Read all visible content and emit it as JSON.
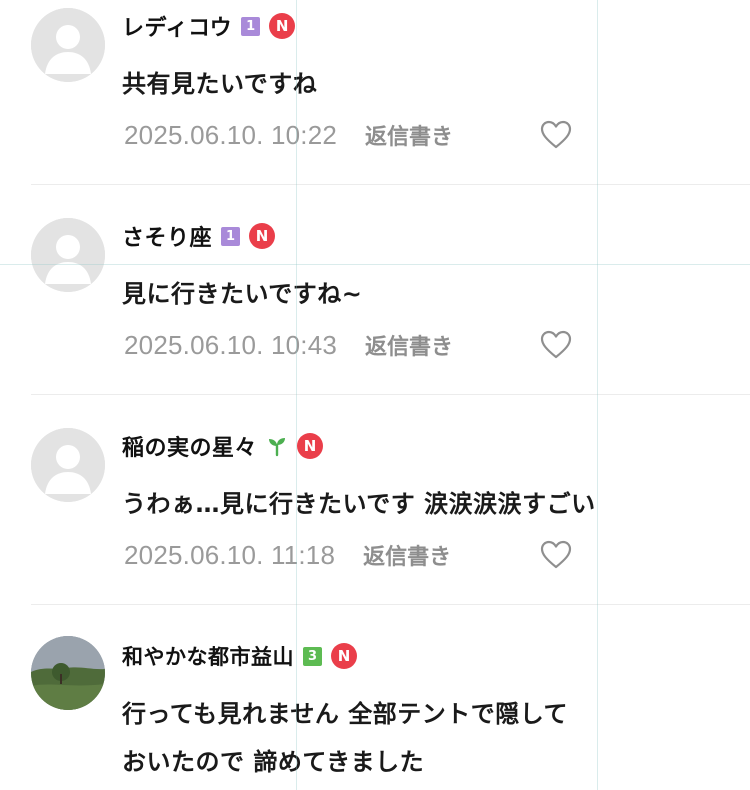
{
  "comments": [
    {
      "nickname": "レディコウ",
      "level": "1",
      "new_badge": "N",
      "text": "共有見たいですね",
      "date": "2025.06.10. 10:22",
      "reply_label": "返信書き"
    },
    {
      "nickname": "さそり座",
      "level": "1",
      "new_badge": "N",
      "text": "見に行きたいですね~",
      "date": "2025.06.10. 10:43",
      "reply_label": "返信書き"
    },
    {
      "nickname": "稲の実の星々",
      "new_badge": "N",
      "text": "うわぁ…見に行きたいです 涙涙涙涙すごい",
      "date": "2025.06.10. 11:18",
      "reply_label": "返信書き"
    },
    {
      "nickname": "和やかな都市益山",
      "level": "3",
      "new_badge": "N",
      "text_line1": "行っても見れません 全部テントで隠して",
      "text_line2": "おいたので 諦めてきました"
    }
  ],
  "colors": {
    "level_purple": "#a98ad9",
    "level_green": "#5dbb52",
    "new_badge": "#ea3e4a",
    "meta_gray": "#9a9a9a"
  },
  "icons": {
    "avatar_default": "default-avatar-icon",
    "like": "heart-outline-icon",
    "sprout": "sprout-icon"
  }
}
